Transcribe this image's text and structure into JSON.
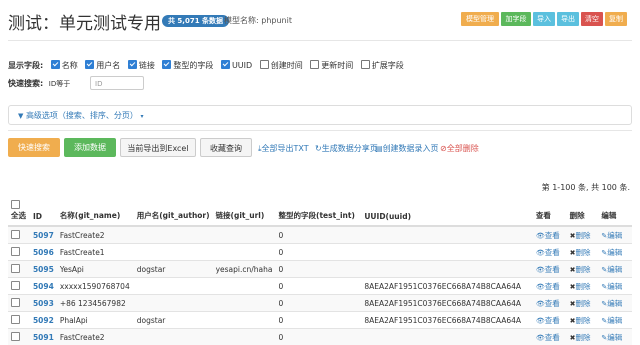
{
  "header": {
    "title": "测试：单元测试专用",
    "count_badge": "共 5,071 条数据",
    "model_name": "模型名称: phpunit",
    "buttons": [
      {
        "label": "模型管理",
        "color": "#f0ad4e"
      },
      {
        "label": "加字段",
        "color": "#5cb85c"
      },
      {
        "label": "导入",
        "color": "#5bc0de"
      },
      {
        "label": "导出",
        "color": "#5bc0de"
      },
      {
        "label": "清空",
        "color": "#d9534f"
      },
      {
        "label": "复制",
        "color": "#f0ad4e"
      }
    ]
  },
  "fields": {
    "label": "显示字段:",
    "items": [
      {
        "label": "名称",
        "checked": true
      },
      {
        "label": "用户名",
        "checked": true
      },
      {
        "label": "链接",
        "checked": true
      },
      {
        "label": "整型的字段",
        "checked": true
      },
      {
        "label": "UUID",
        "checked": true
      },
      {
        "label": "创建时间",
        "checked": false
      },
      {
        "label": "更新时间",
        "checked": false
      },
      {
        "label": "扩展字段",
        "checked": false
      }
    ]
  },
  "quick_search": {
    "label": "快速搜索:",
    "sub_label": "ID等于",
    "placeholder": "ID"
  },
  "advanced": {
    "label": "高级选项（搜索、排序、分页）"
  },
  "actions": {
    "quick_search_btn": "快速搜索",
    "add_data_btn": "添加数据",
    "export_excel_btn": "当前导出到Excel",
    "favorite_btn": "收藏查询",
    "link_export_txt": "全部导出TXT",
    "link_share": "生成数据分享页",
    "link_import": "创建数据录入页",
    "link_delete_all": "全部删除"
  },
  "pager": {
    "info": "第 1-100 条, 共 100 条."
  },
  "table": {
    "headers": {
      "select_all": "全选",
      "id": "ID",
      "name": "名称(git_name)",
      "user": "用户名(git_author)",
      "url": "链接(git_url)",
      "int_field": "整型的字段(test_int)",
      "uuid": "UUID(uuid)",
      "view": "查看",
      "delete": "删除",
      "edit": "编辑"
    },
    "action_labels": {
      "view": "查看",
      "delete": "删除",
      "edit": "编辑"
    },
    "rows": [
      {
        "id": "5097",
        "name": "FastCreate2",
        "user": "",
        "url": "",
        "int_field": "0",
        "uuid": ""
      },
      {
        "id": "5096",
        "name": "FastCreate1",
        "user": "",
        "url": "",
        "int_field": "0",
        "uuid": ""
      },
      {
        "id": "5095",
        "name": "YesApi",
        "user": "dogstar",
        "url": "yesapi.cn/haha",
        "int_field": "0",
        "uuid": ""
      },
      {
        "id": "5094",
        "name": "xxxxx1590768704",
        "user": "",
        "url": "",
        "int_field": "0",
        "uuid": "8AEA2AF1951C0376EC668A74B8CAA64A"
      },
      {
        "id": "5093",
        "name": "+86 1234567982",
        "user": "",
        "url": "",
        "int_field": "0",
        "uuid": "8AEA2AF1951C0376EC668A74B8CAA64A"
      },
      {
        "id": "5092",
        "name": "PhalApi",
        "user": "dogstar",
        "url": "",
        "int_field": "0",
        "uuid": "8AEA2AF1951C0376EC668A74B8CAA64A"
      },
      {
        "id": "5091",
        "name": "FastCreate2",
        "user": "",
        "url": "",
        "int_field": "0",
        "uuid": ""
      }
    ]
  }
}
